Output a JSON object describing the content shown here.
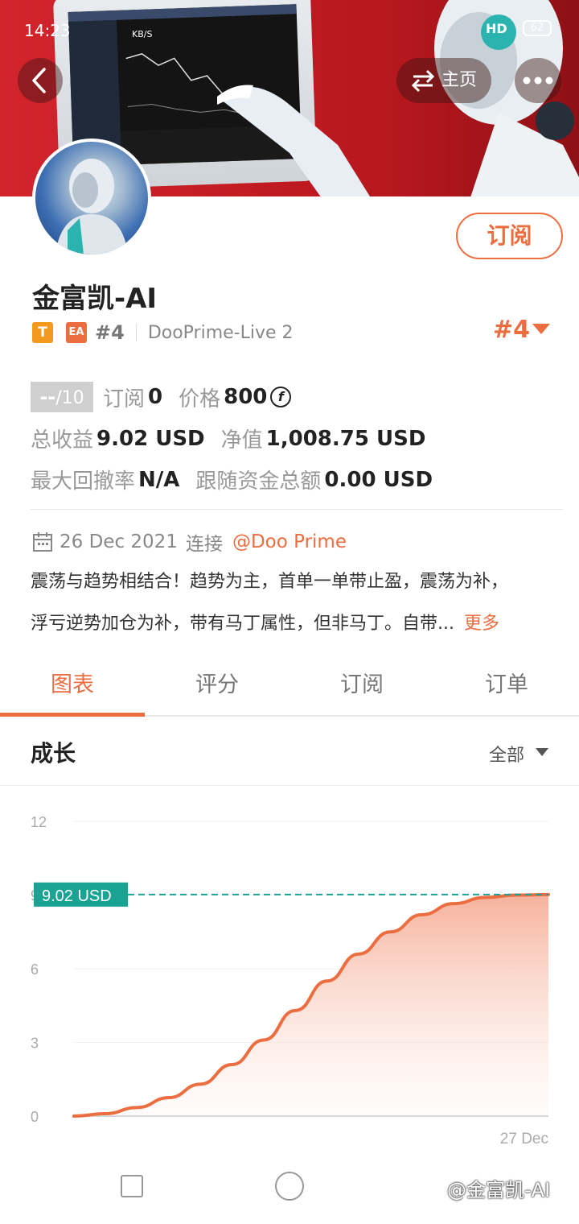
{
  "status_bar": {
    "time": "14:23",
    "speed_unit": "KB/S",
    "network": "HD",
    "battery": "62"
  },
  "header": {
    "home_label": "主页"
  },
  "profile": {
    "name": "金富凯-AI",
    "tag_t": "T",
    "tag_ea": "EA",
    "rank": "#4",
    "server": "DooPrime-Live 2",
    "rank_big": "#4",
    "subscribe_label": "订阅"
  },
  "stats": {
    "score": "--",
    "score_max": "/10",
    "subscribe_label": "订阅",
    "subscribe_count": "0",
    "price_label": "价格",
    "price_value": "800",
    "coin_symbol": "f",
    "total_profit_label": "总收益",
    "total_profit_value": "9.02 USD",
    "equity_label": "净值",
    "equity_value": "1,008.75 USD",
    "drawdown_label": "最大回撤率",
    "drawdown_value": "N/A",
    "follow_label": "跟随资金总额",
    "follow_value": "0.00 USD"
  },
  "connection": {
    "date": "26 Dec 2021",
    "text": "连接",
    "handle": "@Doo Prime"
  },
  "description": {
    "line1": "震荡与趋势相结合！趋势为主，首单一单带止盈，震荡为补，",
    "line2": "浮亏逆势加仓为补，带有马丁属性，但非马丁。自带...",
    "more": "更多"
  },
  "tabs": [
    {
      "label": "图表",
      "active": true
    },
    {
      "label": "评分",
      "active": false
    },
    {
      "label": "订阅",
      "active": false
    },
    {
      "label": "订单",
      "active": false
    }
  ],
  "section": {
    "title": "成长",
    "filter": "全部"
  },
  "colors": {
    "accent": "#ec6d3f",
    "teal": "#1aa392",
    "banner_red": "#c11b22"
  },
  "chart_data": {
    "type": "area",
    "title": "成长",
    "y_ticks": [
      "0",
      "3",
      "6",
      "9",
      "12"
    ],
    "ylim": [
      0,
      12
    ],
    "x_label_end": "27 Dec",
    "current_label": "9.02 USD",
    "current_value": 9.02,
    "series": [
      {
        "values": [
          0,
          0.1,
          0.35,
          0.75,
          1.3,
          2.1,
          3.1,
          4.3,
          5.5,
          6.6,
          7.5,
          8.2,
          8.65,
          8.9,
          9.0,
          9.02
        ]
      }
    ]
  },
  "watermark": "@金富凯-AI"
}
